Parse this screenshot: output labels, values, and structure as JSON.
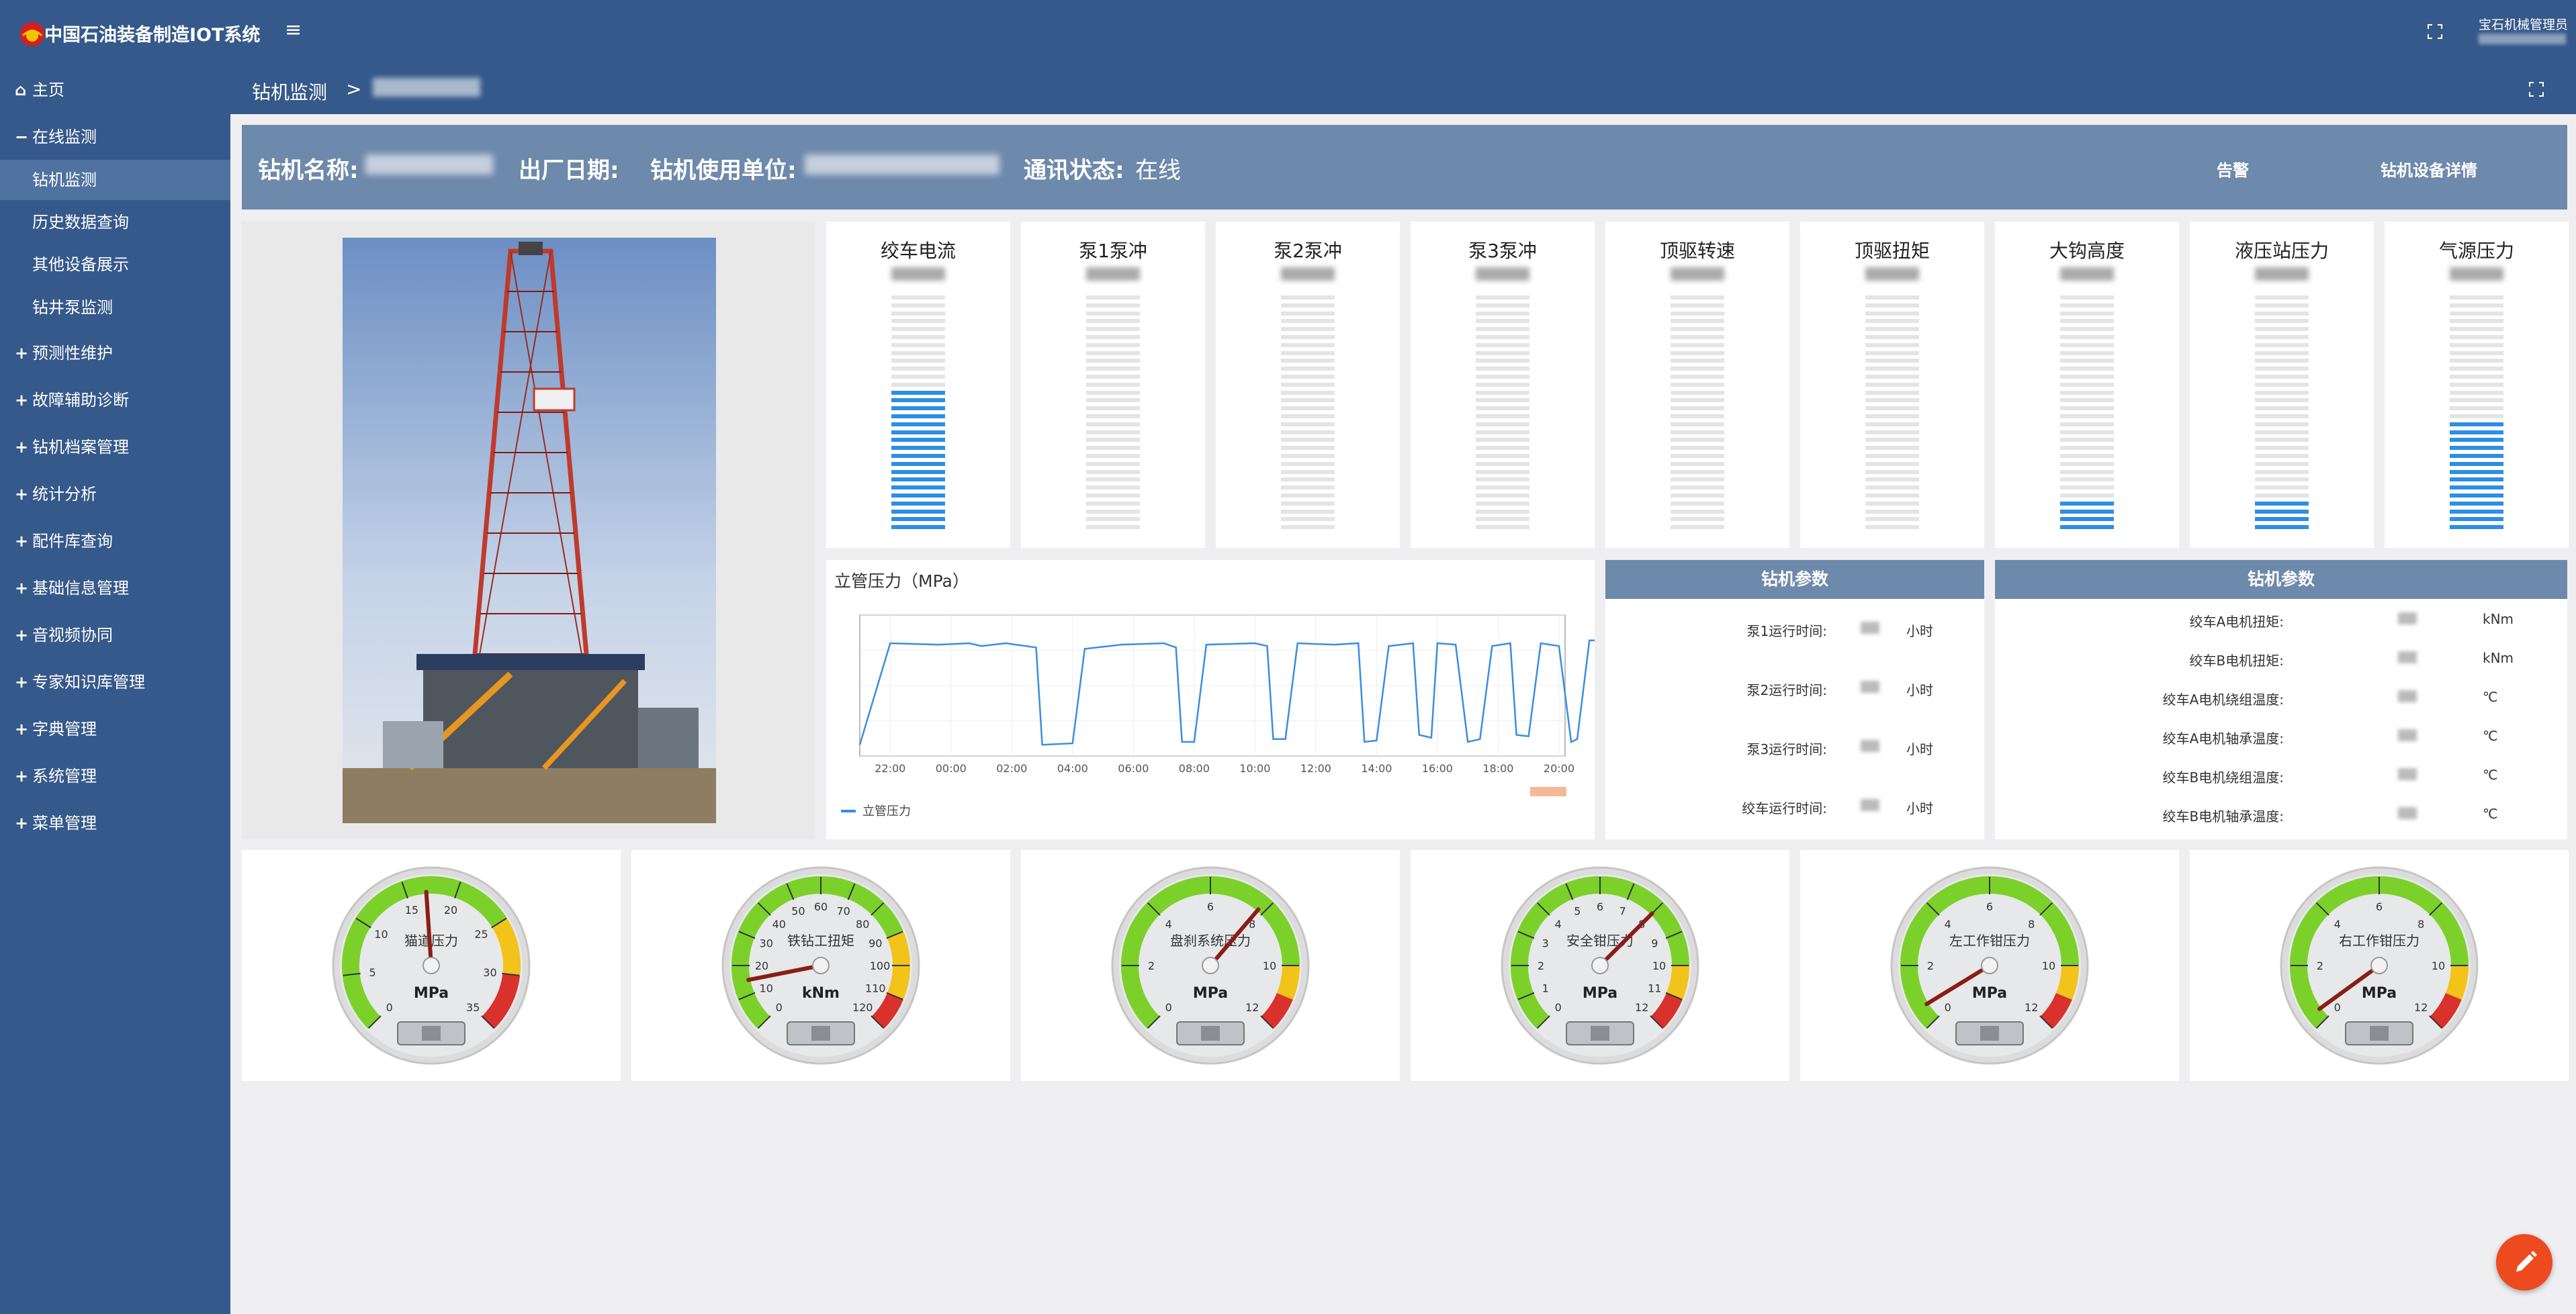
{
  "header": {
    "system_title": "中国石油装备制造IOT系统",
    "user_name": "宝石机械管理员"
  },
  "sidebar": {
    "items": [
      {
        "glyph": "⌂",
        "label": "主页"
      },
      {
        "glyph": "−",
        "label": "在线监测"
      },
      {
        "glyph": "+",
        "label": "预测性维护"
      },
      {
        "glyph": "+",
        "label": "故障辅助诊断"
      },
      {
        "glyph": "+",
        "label": "钻机档案管理"
      },
      {
        "glyph": "+",
        "label": "统计分析"
      },
      {
        "glyph": "+",
        "label": "配件库查询"
      },
      {
        "glyph": "+",
        "label": "基础信息管理"
      },
      {
        "glyph": "+",
        "label": "音视频协同"
      },
      {
        "glyph": "+",
        "label": "专家知识库管理"
      },
      {
        "glyph": "+",
        "label": "字典管理"
      },
      {
        "glyph": "+",
        "label": "系统管理"
      },
      {
        "glyph": "+",
        "label": "菜单管理"
      }
    ],
    "subitems": [
      {
        "label": "钻机监测",
        "active": true
      },
      {
        "label": "历史数据查询",
        "active": false
      },
      {
        "label": "其他设备展示",
        "active": false
      },
      {
        "label": "钻井泵监测",
        "active": false
      }
    ]
  },
  "breadcrumb": {
    "first": "钻机监测",
    "separator": ">"
  },
  "info": {
    "rig_name_label": "钻机名称:",
    "factory_date_label": "出厂日期:",
    "user_unit_label": "钻机使用单位:",
    "comm_status_label": "通讯状态:",
    "comm_status_value": "在线",
    "alarm_link": "告警",
    "detail_link": "钻机设备详情"
  },
  "bar_gauges": [
    {
      "title": "绞车电流",
      "level": 0.59
    },
    {
      "title": "泵1泵冲",
      "level": 0
    },
    {
      "title": "泵2泵冲",
      "level": 0
    },
    {
      "title": "泵3泵冲",
      "level": 0
    },
    {
      "title": "顶驱转速",
      "level": 0
    },
    {
      "title": "顶驱扭矩",
      "level": 0
    },
    {
      "title": "大钩高度",
      "level": 0.12
    },
    {
      "title": "液压站压力",
      "level": 0.14
    },
    {
      "title": "气源压力",
      "level": 0.46
    }
  ],
  "chart_data": {
    "type": "line",
    "title": "立管压力（MPa）",
    "x_ticks": [
      "22:00",
      "00:00",
      "02:00",
      "04:00",
      "06:00",
      "08:00",
      "10:00",
      "12:00",
      "14:00",
      "16:00",
      "18:00",
      "20:00"
    ],
    "series": [
      {
        "name": "立管压力",
        "color": "#3a8ee0"
      }
    ],
    "y_levels": [
      0.8,
      0.09
    ],
    "pattern": [
      [
        0,
        0.08
      ],
      [
        0.5,
        0.8
      ],
      [
        1.3,
        0.79
      ],
      [
        1.8,
        0.8
      ],
      [
        2.0,
        0.78
      ],
      [
        2.4,
        0.8
      ],
      [
        2.9,
        0.77
      ],
      [
        3.0,
        0.08
      ],
      [
        3.5,
        0.09
      ],
      [
        3.7,
        0.76
      ],
      [
        4.3,
        0.79
      ],
      [
        5.0,
        0.8
      ],
      [
        5.2,
        0.77
      ],
      [
        5.3,
        0.1
      ],
      [
        5.5,
        0.1
      ],
      [
        5.7,
        0.79
      ],
      [
        6.5,
        0.8
      ],
      [
        6.7,
        0.78
      ],
      [
        6.8,
        0.12
      ],
      [
        7.0,
        0.12
      ],
      [
        7.2,
        0.8
      ],
      [
        7.8,
        0.79
      ],
      [
        8.2,
        0.8
      ],
      [
        8.3,
        0.1
      ],
      [
        8.5,
        0.11
      ],
      [
        8.7,
        0.78
      ],
      [
        9.1,
        0.8
      ],
      [
        9.2,
        0.15
      ],
      [
        9.4,
        0.13
      ],
      [
        9.5,
        0.8
      ],
      [
        9.8,
        0.79
      ],
      [
        10.0,
        0.1
      ],
      [
        10.2,
        0.12
      ],
      [
        10.4,
        0.78
      ],
      [
        10.7,
        0.8
      ],
      [
        10.8,
        0.15
      ],
      [
        11.0,
        0.14
      ],
      [
        11.2,
        0.8
      ],
      [
        11.5,
        0.78
      ],
      [
        11.7,
        0.1
      ],
      [
        11.8,
        0.12
      ],
      [
        12.0,
        0.82
      ],
      [
        12.4,
        0.82
      ],
      [
        12.8,
        0.83
      ],
      [
        13.0,
        0.8
      ],
      [
        13.3,
        0.82
      ],
      [
        13.5,
        0.81
      ],
      [
        13.7,
        0.1
      ],
      [
        13.8,
        0.1
      ],
      [
        14.0,
        0.8
      ],
      [
        14.5,
        0.81
      ],
      [
        14.8,
        0.82
      ],
      [
        15.0,
        0.12
      ],
      [
        15.2,
        0.12
      ],
      [
        15.4,
        0.8
      ],
      [
        15.8,
        0.81
      ],
      [
        16.0,
        0.1
      ],
      [
        16.1,
        0.12
      ],
      [
        16.3,
        0.78
      ],
      [
        16.6,
        0.8
      ],
      [
        16.8,
        0.1
      ],
      [
        16.9,
        0.11
      ],
      [
        17.1,
        0.79
      ],
      [
        17.4,
        0.81
      ],
      [
        17.6,
        0.1
      ],
      [
        17.7,
        0.11
      ],
      [
        17.9,
        0.82
      ],
      [
        18.2,
        0.8
      ],
      [
        18.4,
        0.15
      ],
      [
        18.5,
        0.12
      ],
      [
        18.7,
        0.82
      ],
      [
        19.0,
        0.8
      ],
      [
        19.2,
        0.11
      ],
      [
        19.3,
        0.1
      ],
      [
        19.5,
        0.82
      ],
      [
        19.8,
        0.8
      ],
      [
        20.0,
        0.1
      ],
      [
        20.1,
        0.12
      ],
      [
        20.3,
        0.85
      ],
      [
        20.5,
        0.83
      ],
      [
        20.7,
        0.8
      ],
      [
        20.8,
        0.86
      ],
      [
        21.0,
        0.78
      ],
      [
        21.2,
        0.1
      ],
      [
        21.3,
        0.12
      ],
      [
        21.4,
        0.8
      ],
      [
        21.6,
        0.82
      ],
      [
        21.8,
        0.78
      ],
      [
        22.0,
        0.08
      ],
      [
        22.6,
        0.08
      ]
    ]
  },
  "params_left": {
    "title": "钻机参数",
    "rows": [
      {
        "label": "泵1运行时间:",
        "unit": "小时"
      },
      {
        "label": "泵2运行时间:",
        "unit": "小时"
      },
      {
        "label": "泵3运行时间:",
        "unit": "小时"
      },
      {
        "label": "绞车运行时间:",
        "unit": "小时"
      }
    ]
  },
  "params_right": {
    "title": "钻机参数",
    "rows": [
      {
        "label": "绞车A电机扭矩:",
        "unit": "kNm"
      },
      {
        "label": "绞车B电机扭矩:",
        "unit": "kNm"
      },
      {
        "label": "绞车A电机绕组温度:",
        "unit": "℃"
      },
      {
        "label": "绞车A电机轴承温度:",
        "unit": "℃"
      },
      {
        "label": "绞车B电机绕组温度:",
        "unit": "℃"
      },
      {
        "label": "绞车B电机轴承温度:",
        "unit": "℃"
      }
    ]
  },
  "dials": [
    {
      "label": "猫道压力",
      "unit": "MPa",
      "max": 35,
      "ticks": [
        0,
        5,
        10,
        15,
        20,
        25,
        30,
        35
      ],
      "yellow_from": 25,
      "red_from": 30,
      "value": 17
    },
    {
      "label": "铁钻工扭矩",
      "unit": "kNm",
      "max": 120,
      "ticks": [
        0,
        10,
        20,
        30,
        40,
        50,
        60,
        70,
        80,
        90,
        100,
        110,
        120
      ],
      "yellow_from": 90,
      "red_from": 110,
      "value": 15
    },
    {
      "label": "盘刹系统压力",
      "unit": "MPa",
      "max": 12,
      "ticks": [
        0,
        2,
        4,
        6,
        8,
        10,
        12
      ],
      "yellow_from": 10,
      "red_from": 11,
      "value": 7.8
    },
    {
      "label": "安全钳压力",
      "unit": "MPa",
      "max": 12,
      "ticks": [
        0,
        1,
        2,
        3,
        4,
        5,
        6,
        7,
        8,
        9,
        10,
        11,
        12
      ],
      "yellow_from": 10,
      "red_from": 11,
      "value": 8
    },
    {
      "label": "左工作钳压力",
      "unit": "MPa",
      "max": 12,
      "ticks": [
        0,
        2,
        4,
        6,
        8,
        10,
        12
      ],
      "yellow_from": 10,
      "red_from": 11,
      "value": 0.6
    },
    {
      "label": "右工作钳压力",
      "unit": "MPa",
      "max": 12,
      "ticks": [
        0,
        2,
        4,
        6,
        8,
        10,
        12
      ],
      "yellow_from": 10,
      "red_from": 11,
      "value": 0.4
    }
  ],
  "colors": {
    "brand": "#35598a",
    "header_band": "#6d89ab",
    "bar_active": "#2d8ee6",
    "bar_inactive": "#e4e4e4",
    "fab": "#ee4a1f"
  }
}
